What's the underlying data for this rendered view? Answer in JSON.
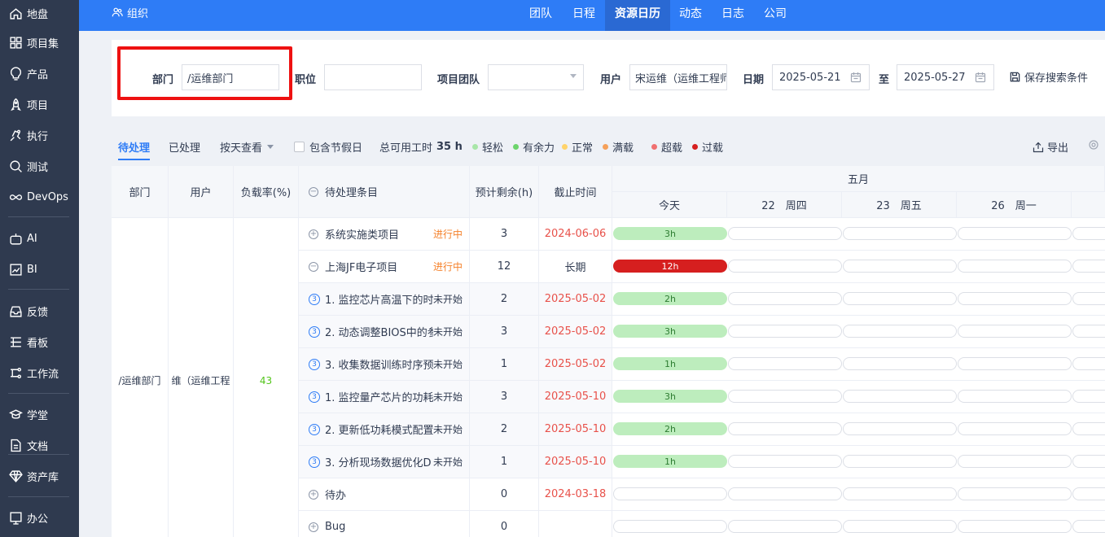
{
  "sidebar": {
    "items": [
      {
        "label": "地盘",
        "icon": "home-icon"
      },
      {
        "label": "项目集",
        "icon": "grid-icon"
      },
      {
        "label": "产品",
        "icon": "lightbulb-icon"
      },
      {
        "label": "项目",
        "icon": "rocket-icon"
      },
      {
        "label": "执行",
        "icon": "run-icon"
      },
      {
        "label": "测试",
        "icon": "magnifier-icon"
      },
      {
        "label": "DevOps",
        "icon": "infinity-icon"
      },
      {
        "label": "AI",
        "icon": "robot-icon"
      },
      {
        "label": "BI",
        "icon": "chart-icon"
      },
      {
        "label": "反馈",
        "icon": "inbox-icon"
      },
      {
        "label": "看板",
        "icon": "board-icon"
      },
      {
        "label": "工作流",
        "icon": "workflow-icon"
      },
      {
        "label": "学堂",
        "icon": "academy-icon"
      },
      {
        "label": "文档",
        "icon": "doc-icon"
      },
      {
        "label": "资产库",
        "icon": "diamond-icon"
      },
      {
        "label": "办公",
        "icon": "oa-icon"
      }
    ]
  },
  "topbar": {
    "org_label": "组织",
    "tabs": [
      "团队",
      "日程",
      "资源日历",
      "动态",
      "日志",
      "公司"
    ],
    "active_tab": "资源日历"
  },
  "filter": {
    "dept_label": "部门",
    "dept_value": "/运维部门",
    "position_label": "职位",
    "position_value": "",
    "team_label": "项目团队",
    "team_value": "",
    "user_label": "用户",
    "user_value": "宋运维（运维工程师",
    "date_label": "日期",
    "date_start": "2025-05-21",
    "to_label": "至",
    "date_end": "2025-05-27",
    "save_label": "保存搜索条件"
  },
  "toolbar": {
    "pending": "待处理",
    "done": "已处理",
    "view": "按天查看",
    "holiday": "包含节假日",
    "total_label": "总可用工时",
    "total_value": "35 h",
    "export": "导出",
    "legend": [
      {
        "label": "轻松",
        "color": "#a8e6a8"
      },
      {
        "label": "有余力",
        "color": "#6cd46c"
      },
      {
        "label": "正常",
        "color": "#ffd36a"
      },
      {
        "label": "满载",
        "color": "#f5a05a"
      },
      {
        "label": "超载",
        "color": "#f07070"
      },
      {
        "label": "过载",
        "color": "#d61f1f"
      }
    ]
  },
  "table": {
    "headers": {
      "dept": "部门",
      "user": "用户",
      "load": "负载率(%)",
      "item": "待处理条目",
      "remain": "预计剩余(h)",
      "deadline": "截止时间",
      "month": "五月",
      "days": [
        "今天",
        "22　周四",
        "23　周五",
        "26　周一"
      ]
    },
    "group": {
      "dept": "/运维部门",
      "user": "维（运维工程",
      "load": "43"
    },
    "rows": [
      {
        "type": "parent",
        "toggle": "+",
        "title": "系统实施类项目",
        "status": "进行中",
        "remain": "3",
        "deadline": "2024-06-06",
        "deadline_red": true,
        "bar": "3h",
        "bar_color": "green"
      },
      {
        "type": "parent",
        "toggle": "−",
        "title": "上海JF电子项目",
        "status": "进行中",
        "remain": "12",
        "deadline": "长期",
        "deadline_red": false,
        "bar": "12h",
        "bar_color": "red"
      },
      {
        "type": "child",
        "idx": "3",
        "title": "1. 监控芯片高温下的时",
        "status": "未开始",
        "remain": "2",
        "deadline": "2025-05-02",
        "deadline_red": true,
        "bar": "2h",
        "bar_color": "green"
      },
      {
        "type": "child",
        "idx": "3",
        "title": "2. 动态调整BIOS中的参",
        "status": "未开始",
        "remain": "3",
        "deadline": "2025-05-02",
        "deadline_red": true,
        "bar": "3h",
        "bar_color": "green"
      },
      {
        "type": "child",
        "idx": "3",
        "title": "3. 收集数据训练时序预",
        "status": "未开始",
        "remain": "1",
        "deadline": "2025-05-02",
        "deadline_red": true,
        "bar": "1h",
        "bar_color": "green"
      },
      {
        "type": "child",
        "idx": "3",
        "title": "1. 监控量产芯片的功耗",
        "status": "未开始",
        "remain": "3",
        "deadline": "2025-05-10",
        "deadline_red": true,
        "bar": "3h",
        "bar_color": "green"
      },
      {
        "type": "child",
        "idx": "3",
        "title": "2. 更新低功耗模式配置",
        "status": "未开始",
        "remain": "2",
        "deadline": "2025-05-10",
        "deadline_red": true,
        "bar": "2h",
        "bar_color": "green"
      },
      {
        "type": "child",
        "idx": "3",
        "title": "3. 分析现场数据优化D",
        "status": "未开始",
        "remain": "1",
        "deadline": "2025-05-10",
        "deadline_red": true,
        "bar": "1h",
        "bar_color": "green"
      },
      {
        "type": "parent",
        "toggle": "+",
        "title": "待办",
        "status": "",
        "remain": "0",
        "deadline": "2024-03-18",
        "deadline_red": true,
        "bar": "",
        "bar_color": "empty"
      },
      {
        "type": "parent",
        "toggle": "+",
        "title": "Bug",
        "status": "",
        "remain": "0",
        "deadline": "",
        "deadline_red": false,
        "bar": "",
        "bar_color": "empty"
      }
    ]
  }
}
